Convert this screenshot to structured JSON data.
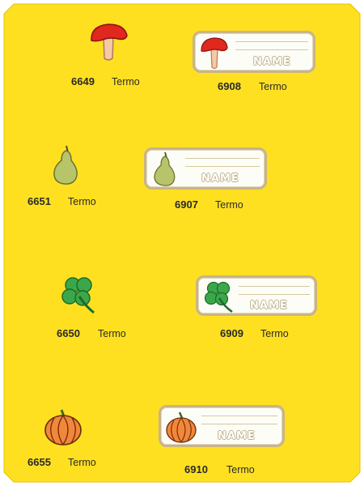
{
  "colors": {
    "background": "#FFE020",
    "frame_edge": "#c9a800",
    "patch_border": "#c8b48a"
  },
  "products": [
    {
      "code": "6649",
      "desc": "Termo",
      "icon": "mushroom-icon",
      "type": "badge"
    },
    {
      "code": "6908",
      "desc": "Termo",
      "icon": "mushroom-icon",
      "type": "name-patch",
      "label": "NAME"
    },
    {
      "code": "6651",
      "desc": "Termo",
      "icon": "pear-icon",
      "type": "badge"
    },
    {
      "code": "6907",
      "desc": "Termo",
      "icon": "pear-icon",
      "type": "name-patch",
      "label": "NAME"
    },
    {
      "code": "6650",
      "desc": "Termo",
      "icon": "clover-icon",
      "type": "badge"
    },
    {
      "code": "6909",
      "desc": "Termo",
      "icon": "clover-icon",
      "type": "name-patch",
      "label": "NAME"
    },
    {
      "code": "6655",
      "desc": "Termo",
      "icon": "pumpkin-icon",
      "type": "badge"
    },
    {
      "code": "6910",
      "desc": "Termo",
      "icon": "pumpkin-icon",
      "type": "name-patch",
      "label": "NAME"
    }
  ]
}
